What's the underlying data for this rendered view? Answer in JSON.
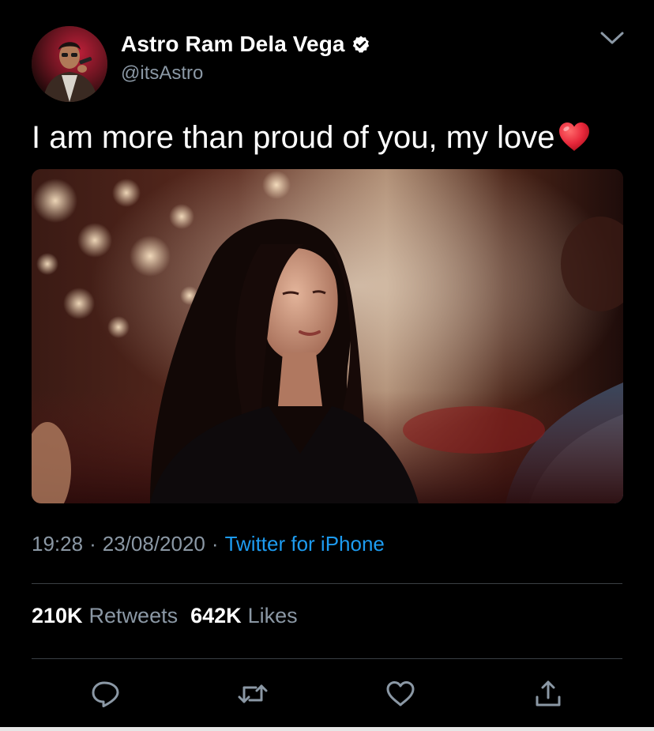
{
  "author": {
    "display_name": "Astro Ram Dela Vega",
    "handle": "@itsAstro",
    "verified": true,
    "avatar_icon": "avatar-photo"
  },
  "tweet": {
    "text": "I am more than proud of you, my love",
    "emoji": "red-heart-emoji",
    "media_icon": "tweet-photo"
  },
  "meta": {
    "time": "19:28",
    "separator": "·",
    "date": "23/08/2020",
    "source": "Twitter for iPhone"
  },
  "stats": {
    "retweets_count": "210K",
    "retweets_label": "Retweets",
    "likes_count": "642K",
    "likes_label": "Likes"
  },
  "actions": {
    "reply_icon": "reply-icon",
    "retweet_icon": "retweet-icon",
    "like_icon": "heart-icon",
    "share_icon": "share-icon"
  },
  "colors": {
    "background": "#000000",
    "text_primary": "#ffffff",
    "text_secondary": "#8b98a5",
    "link": "#1d9bf0",
    "divider": "#3a3f44",
    "heart_red": "#e8283b"
  }
}
